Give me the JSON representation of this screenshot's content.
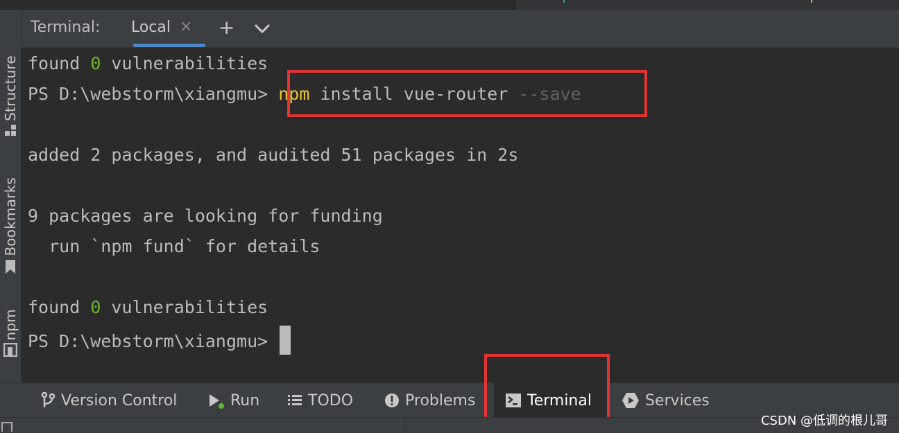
{
  "terminal_header": {
    "title": "Terminal:",
    "tab_label": "Local",
    "tab_close": "×",
    "new_tab": "+",
    "dropdown": "⌄"
  },
  "left_stripe": {
    "items": [
      {
        "label": "Structure",
        "icon": "structure-icon"
      },
      {
        "label": "Bookmarks",
        "icon": "bookmark-icon"
      },
      {
        "label": "npm",
        "icon": "npm-icon"
      }
    ]
  },
  "terminal": {
    "line1": {
      "pre": "found ",
      "num": "0",
      "post": " vulnerabilities"
    },
    "line2": {
      "prompt": "PS D:\\webstorm\\xiangmu> ",
      "cmd": "npm",
      "args": " install vue-router ",
      "flag": "--save"
    },
    "line3": "added 2 packages, and audited 51 packages in 2s",
    "line4": "9 packages are looking for funding",
    "line5": "  run `npm fund` for details",
    "line6": {
      "pre": "found ",
      "num": "0",
      "post": " vulnerabilities"
    },
    "line7": {
      "prompt": "PS D:\\webstorm\\xiangmu> "
    }
  },
  "bottom_bar": {
    "items": [
      {
        "label": "Version Control",
        "icon": "version-control-icon"
      },
      {
        "label": "Run",
        "icon": "run-icon"
      },
      {
        "label": "TODO",
        "icon": "todo-icon"
      },
      {
        "label": "Problems",
        "icon": "problems-icon"
      },
      {
        "label": "Terminal",
        "icon": "terminal-icon",
        "active": true
      },
      {
        "label": "Services",
        "icon": "services-icon"
      }
    ]
  },
  "watermark": "CSDN @低调的根儿哥",
  "colors": {
    "background": "#2b2b2b",
    "panel": "#3c3f41",
    "text": "#bbbbbb",
    "number_green": "#6ab82a",
    "command_yellow": "#f0c32c",
    "flag_dim": "#606366",
    "highlight_red": "#e33434",
    "tab_underline": "#4a88c7"
  }
}
